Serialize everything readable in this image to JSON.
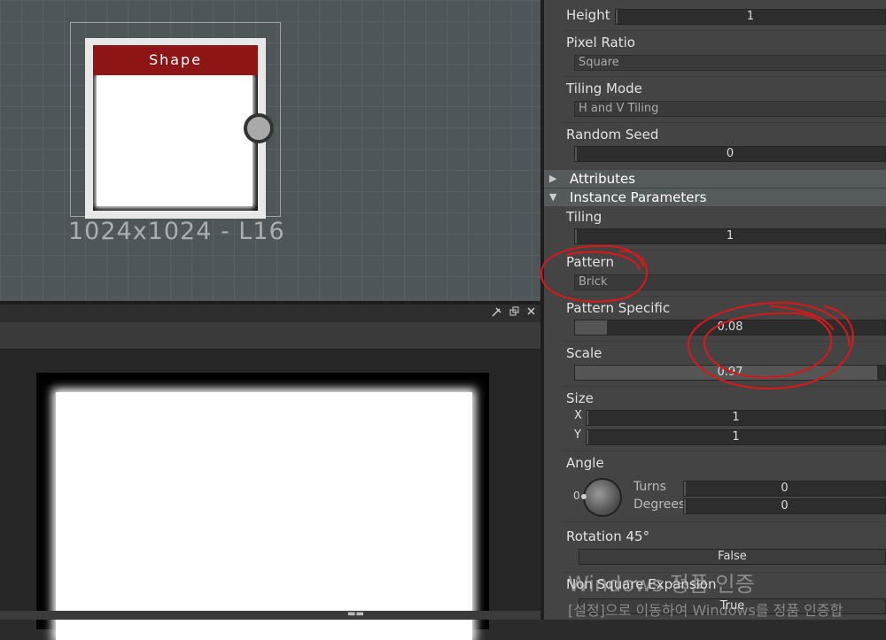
{
  "graph": {
    "node_title": "Shape",
    "node_caption": "1024x1024 - L16"
  },
  "view2d": {
    "titlebar_icons": [
      "pin-icon",
      "restore-icon",
      "close-icon"
    ]
  },
  "props": {
    "height": {
      "label": "Height",
      "value": "1"
    },
    "pixel_ratio": {
      "label": "Pixel Ratio",
      "value": "Square"
    },
    "tiling_mode": {
      "label": "Tiling Mode",
      "value": "H and V Tiling"
    },
    "random_seed": {
      "label": "Random Seed",
      "value": "0"
    },
    "attributes": {
      "label": "Attributes",
      "expanded": false
    },
    "instance_parameters": {
      "label": "Instance Parameters",
      "expanded": true
    },
    "tiling": {
      "label": "Tiling",
      "value": "1"
    },
    "pattern": {
      "label": "Pattern",
      "value": "Brick"
    },
    "pattern_specific": {
      "label": "Pattern Specific",
      "value": "0.08"
    },
    "scale": {
      "label": "Scale",
      "value": "0.97"
    },
    "size": {
      "label": "Size",
      "x_label": "X",
      "x_value": "1",
      "y_label": "Y",
      "y_value": "1"
    },
    "angle": {
      "label": "Angle",
      "dial_value": "0",
      "turns_label": "Turns",
      "turns_value": "0",
      "degrees_label": "Degrees",
      "degrees_value": "0"
    },
    "rotation45": {
      "label": "Rotation 45°",
      "value": "False"
    },
    "non_square_expansion": {
      "label": "Non Square Expansion",
      "value": "True"
    }
  },
  "watermark": {
    "line1": "Windows 정품 인증",
    "line2": "[설정]으로 이동하여 Windows를 정품 인증합"
  },
  "colors": {
    "node_header": "#8e1515",
    "annotation": "#d11a1a"
  }
}
